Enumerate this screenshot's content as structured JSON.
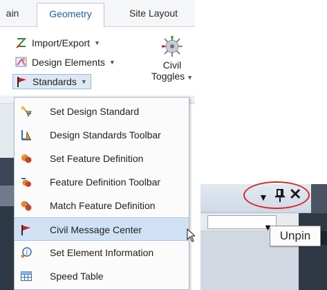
{
  "ribbon": {
    "tabs": [
      "ain",
      "Geometry",
      "Site Layout"
    ],
    "active_tab": "Geometry",
    "items": [
      {
        "label": "Import/Export",
        "icon": "import-export-icon"
      },
      {
        "label": "Design Elements",
        "icon": "design-elements-icon"
      },
      {
        "label": "Standards",
        "icon": "standards-flag-icon"
      }
    ],
    "civil_toggles": {
      "line1": "Civil",
      "line2": "Toggles",
      "icon": "civil-toggles-icon"
    }
  },
  "standards_menu": {
    "items": [
      {
        "label": "Set Design Standard",
        "icon": "set-design-standard-icon"
      },
      {
        "label": "Design Standards Toolbar",
        "icon": "design-standards-toolbar-icon"
      },
      {
        "label": "Set Feature Definition",
        "icon": "set-feature-definition-icon"
      },
      {
        "label": "Feature Definition Toolbar",
        "icon": "feature-definition-toolbar-icon"
      },
      {
        "label": "Match Feature Definition",
        "icon": "match-feature-definition-icon"
      },
      {
        "label": "Civil Message Center",
        "icon": "civil-message-center-icon"
      },
      {
        "label": "Set Element Information",
        "icon": "set-element-information-icon"
      },
      {
        "label": "Speed Table",
        "icon": "speed-table-icon"
      }
    ],
    "highlighted": "Civil Message Center"
  },
  "panel_zoom": {
    "tooltip": "Unpin",
    "controls": [
      "dropdown-arrow-icon",
      "pin-icon",
      "close-icon"
    ]
  },
  "colors": {
    "accent": "#1f5fa8",
    "highlight": "#cfe1f3",
    "annotation": "#d12b2b"
  }
}
